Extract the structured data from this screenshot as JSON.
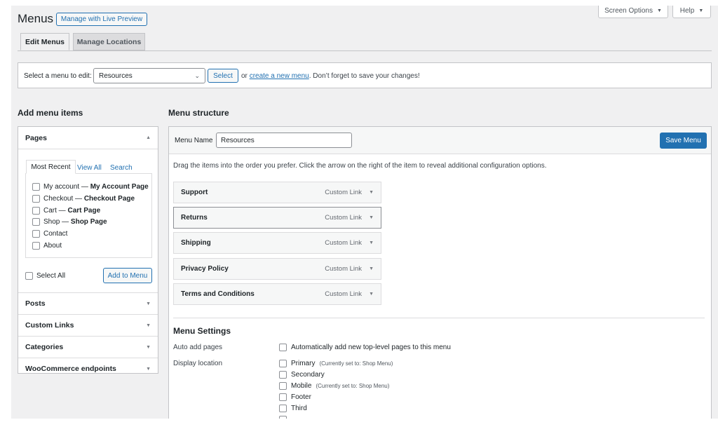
{
  "header": {
    "title": "Menus",
    "live_preview_label": "Manage with Live Preview",
    "screen_options_label": "Screen Options",
    "help_label": "Help"
  },
  "tabs": [
    {
      "label": "Edit Menus",
      "active": true
    },
    {
      "label": "Manage Locations",
      "active": false
    }
  ],
  "select_bar": {
    "prompt": "Select a menu to edit:",
    "selected": "Resources",
    "select_button": "Select",
    "or_text": "or",
    "create_link": "create a new menu",
    "tail_text": ". Don’t forget to save your changes!"
  },
  "add_items": {
    "heading": "Add menu items",
    "pages_title": "Pages",
    "subtabs": [
      "Most Recent",
      "View All",
      "Search"
    ],
    "pages": [
      {
        "name": "My account",
        "sep": " — ",
        "desc": "My Account Page"
      },
      {
        "name": "Checkout",
        "sep": " — ",
        "desc": "Checkout Page"
      },
      {
        "name": "Cart",
        "sep": " — ",
        "desc": "Cart Page"
      },
      {
        "name": "Shop",
        "sep": " — ",
        "desc": "Shop Page"
      },
      {
        "name": "Contact",
        "sep": "",
        "desc": ""
      },
      {
        "name": "About",
        "sep": "",
        "desc": ""
      }
    ],
    "select_all": "Select All",
    "add_button": "Add to Menu",
    "sections": [
      "Posts",
      "Custom Links",
      "Categories",
      "WooCommerce endpoints"
    ]
  },
  "structure": {
    "heading": "Menu structure",
    "menu_name_label": "Menu Name",
    "menu_name_value": "Resources",
    "save_button": "Save Menu",
    "instructions": "Drag the items into the order you prefer. Click the arrow on the right of the item to reveal additional configuration options.",
    "items": [
      {
        "title": "Support",
        "type": "Custom Link"
      },
      {
        "title": "Returns",
        "type": "Custom Link"
      },
      {
        "title": "Shipping",
        "type": "Custom Link"
      },
      {
        "title": "Privacy Policy",
        "type": "Custom Link"
      },
      {
        "title": "Terms and Conditions",
        "type": "Custom Link"
      }
    ]
  },
  "settings": {
    "heading": "Menu Settings",
    "auto_add_label": "Auto add pages",
    "auto_add_text": "Automatically add new top-level pages to this menu",
    "display_label": "Display location",
    "locations": [
      {
        "name": "Primary",
        "note": "(Currently set to: Shop Menu)"
      },
      {
        "name": "Secondary",
        "note": ""
      },
      {
        "name": "Mobile",
        "note": "(Currently set to: Shop Menu)"
      },
      {
        "name": "Footer",
        "note": ""
      },
      {
        "name": "Third",
        "note": ""
      }
    ]
  },
  "colors": {
    "accent": "#2271b1",
    "background": "#f0f0f1"
  }
}
